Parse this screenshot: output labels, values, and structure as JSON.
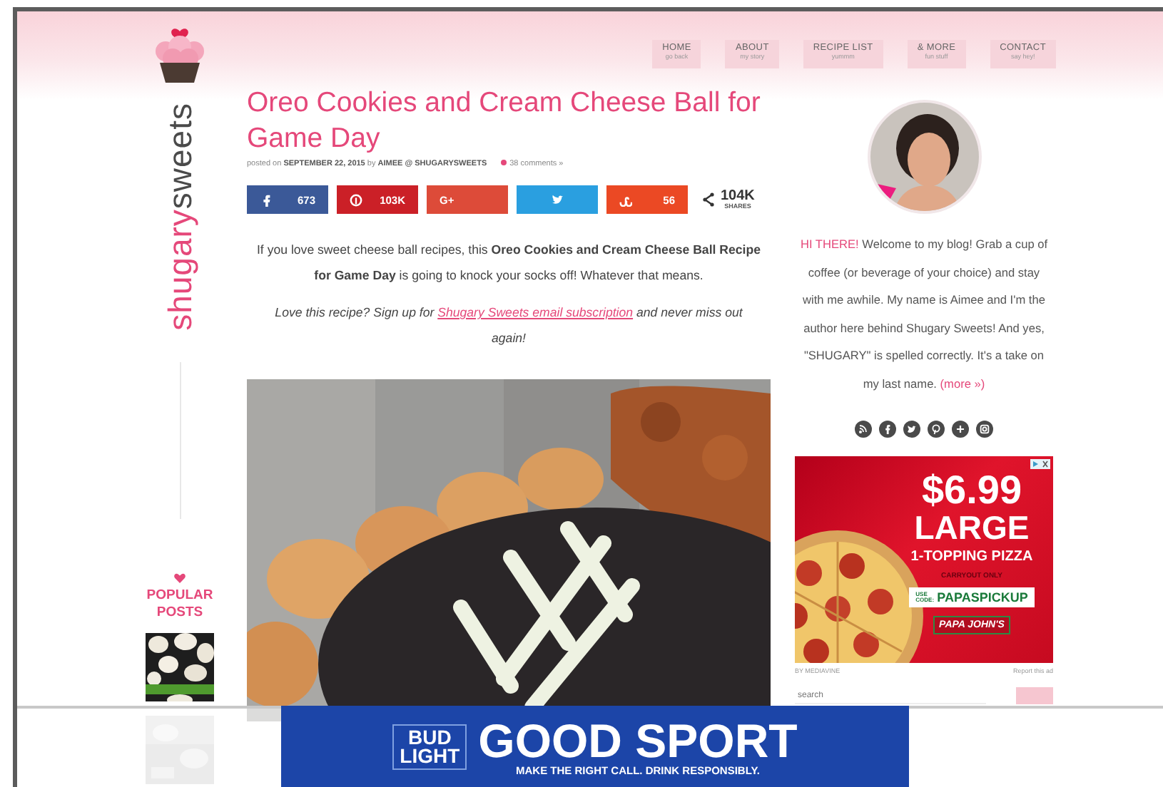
{
  "logo": {
    "word_1": "shugary",
    "word_2": "sweets"
  },
  "nav": [
    {
      "label": "HOME",
      "sub": "go back"
    },
    {
      "label": "ABOUT",
      "sub": "my story"
    },
    {
      "label": "RECIPE LIST",
      "sub": "yummm"
    },
    {
      "label": "& MORE",
      "sub": "fun stuff"
    },
    {
      "label": "CONTACT",
      "sub": "say hey!"
    }
  ],
  "post": {
    "title": "Oreo Cookies and Cream Cheese Ball for Game Day",
    "meta": {
      "prefix": "posted on",
      "date": "SEPTEMBER 22, 2015",
      "by": "by",
      "author": "AIMEE @ SHUGARYSWEETS",
      "comments": "38 comments »"
    },
    "share": [
      {
        "kind": "facebook",
        "count": "673"
      },
      {
        "kind": "pinterest",
        "count": "103K"
      },
      {
        "kind": "google",
        "label": "G+"
      },
      {
        "kind": "twitter"
      },
      {
        "kind": "stumbleupon",
        "count": "56"
      }
    ],
    "share_total": {
      "count": "104K",
      "label": "SHARES"
    },
    "intro": "If you love sweet cheese ball recipes, this **Oreo Cookies and Cream Cheese Ball Recipe for Game Day** is going to knock your socks off! Whatever that means.",
    "signup": {
      "before": "Love this recipe? Sign up for ",
      "link": "Shugary Sweets email subscription",
      "after": " and never miss out again!"
    }
  },
  "popular": {
    "title": "POPULAR POSTS"
  },
  "sidebar": {
    "greeting": "HI THERE!",
    "bio": " Welcome to my blog! Grab a cup of coffee (or beverage of your choice) and stay with me awhile. My name is Aimee and I'm the author here behind Shugary Sweets! And yes, \"SHUGARY\" is spelled correctly. It's a take on my last name. ",
    "more": "(more »)",
    "social": [
      {
        "kind": "rss"
      },
      {
        "kind": "facebook"
      },
      {
        "kind": "twitter"
      },
      {
        "kind": "pinterest"
      },
      {
        "kind": "google-plus"
      },
      {
        "kind": "instagram"
      }
    ],
    "ad": {
      "price": "$6.99",
      "size": "LARGE",
      "item": "1-TOPPING PIZZA",
      "note": "CARRYOUT ONLY",
      "code_label": "USE CODE:",
      "code": "PAPASPICKUP",
      "brand": "PAPA JOHN'S",
      "by": "BY MEDIAVINE",
      "report": "Report this ad"
    },
    "search": {
      "placeholder": "search"
    }
  },
  "banner": {
    "brand_line_1": "BUD",
    "brand_line_2": "LIGHT",
    "headline": "GOOD SPORT",
    "tagline": "MAKE THE RIGHT CALL. DRINK RESPONSIBLY."
  }
}
